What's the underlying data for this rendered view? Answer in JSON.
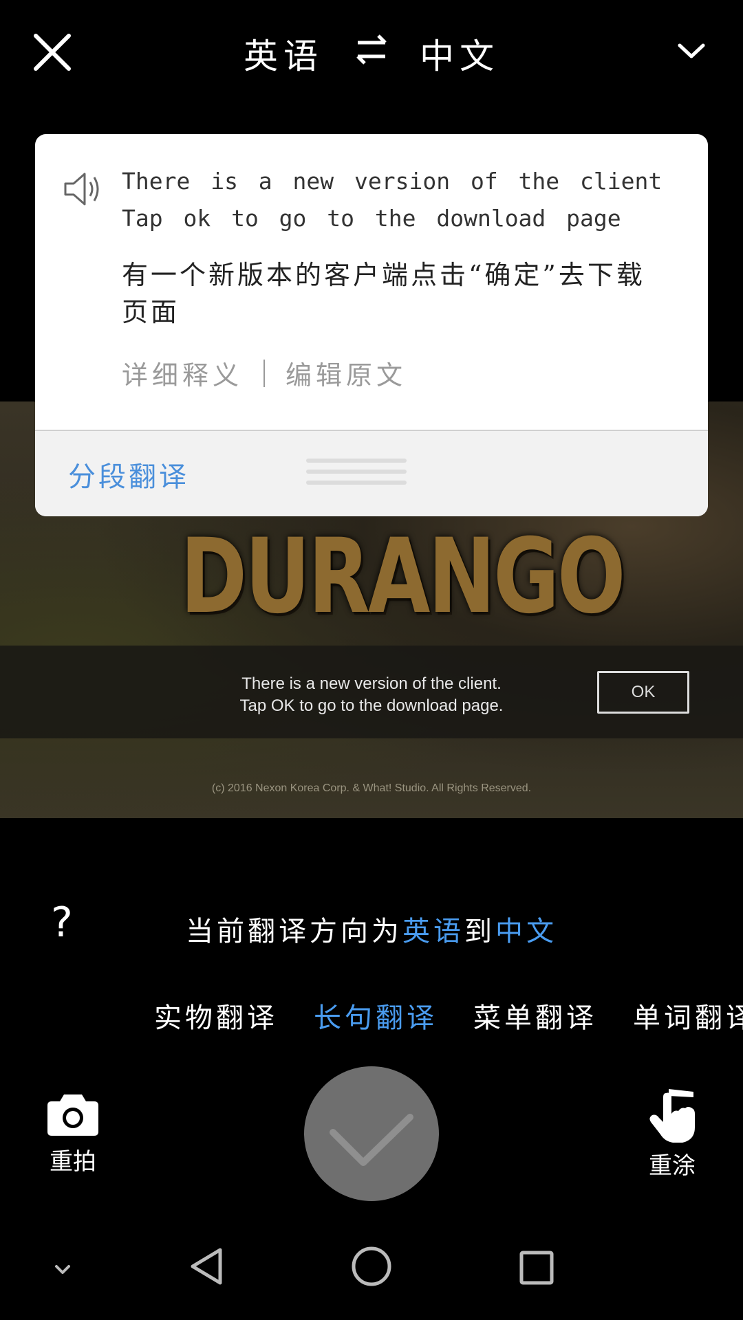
{
  "header": {
    "source_language": "英语",
    "target_language": "中文",
    "close_icon": "close-icon",
    "swap_icon": "swap-icon",
    "dropdown_icon": "chevron-down-icon"
  },
  "captured_image": {
    "logo_text": "DURANGO",
    "dialog_message_line1": "There is a new version of the client.",
    "dialog_message_line2": "Tap OK to go to the download page.",
    "dialog_ok": "OK",
    "copyright": "(c) 2016 Nexon Korea Corp. & What! Studio. All Rights Reserved."
  },
  "translation_card": {
    "source_text": "There is a new version of the client Tap ok to go to the download page",
    "translated_text": "有一个新版本的客户端点击“确定”去下载页面",
    "detail_link": "详细释义",
    "edit_link": "编辑原文",
    "segment_translate": "分段翻译",
    "accent_color": "#4a8fdb"
  },
  "direction_hint": {
    "prefix": "当前翻译方向为",
    "from": "英语",
    "middle": "到",
    "to": "中文"
  },
  "modes": [
    {
      "label": "实物翻译",
      "active": false
    },
    {
      "label": "长句翻译",
      "active": true
    },
    {
      "label": "菜单翻译",
      "active": false
    },
    {
      "label": "单词翻译",
      "active": false
    }
  ],
  "controls": {
    "retake_label": "重拍",
    "repaint_label": "重涂",
    "help_symbol": "?"
  }
}
